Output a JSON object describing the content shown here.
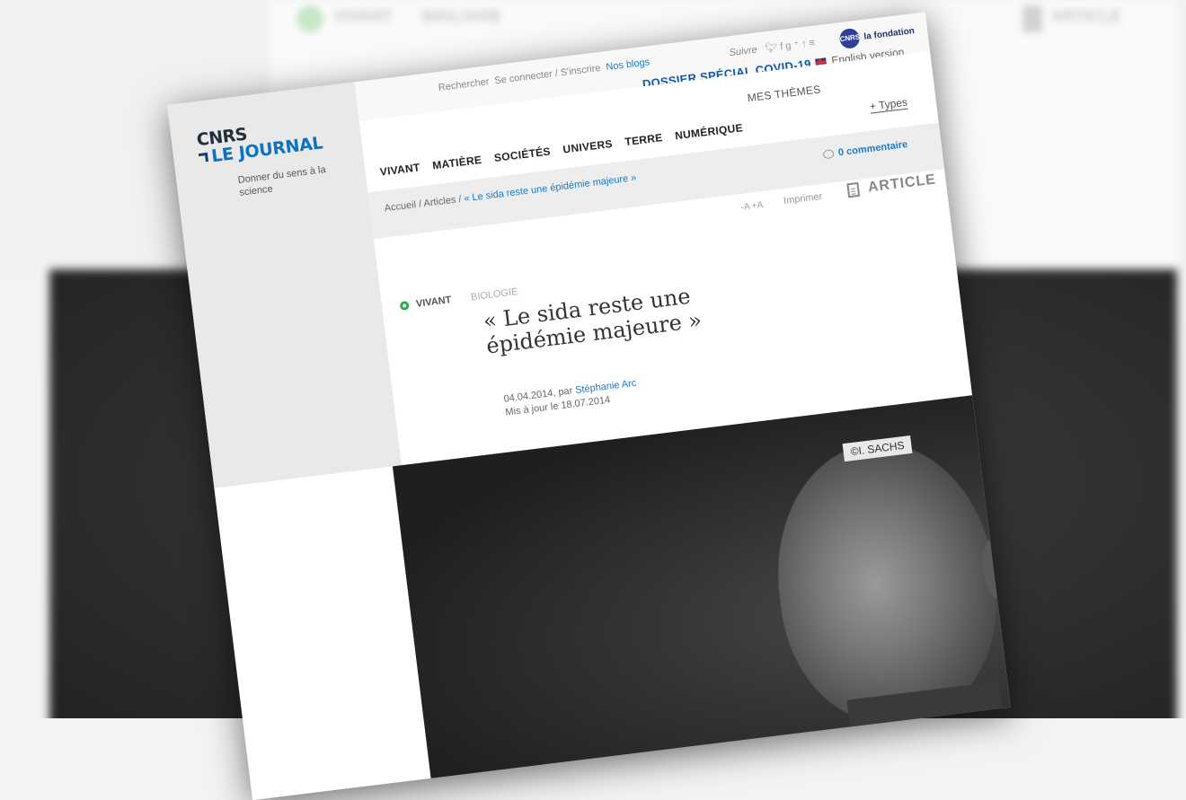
{
  "background": {
    "left_word": "VIVANT",
    "right_word": "BIOLOGIE",
    "article_word": "ARTICLE"
  },
  "logo": {
    "line1": "CNRS",
    "line2": "LE JOURNAL",
    "tagline": "Donner du sens à la science"
  },
  "topbar": {
    "search": "Rechercher",
    "login": "Se connecter / S'inscrire",
    "blogs": "Nos blogs",
    "follow": "Suivre",
    "social_icons": [
      "twitter-icon",
      "facebook-icon",
      "google-plus-icon",
      "share-icon",
      "rss-icon"
    ],
    "fondation": "la fondation",
    "fondation_badge": "CNRS",
    "covid": "DOSSIER SPÉCIAL COVID-19",
    "english": "English version"
  },
  "nav": {
    "items": [
      "VIVANT",
      "MATIÈRE",
      "SOCIÉTÉS",
      "UNIVERS",
      "TERRE",
      "NUMÉRIQUE"
    ],
    "mes_themes": "MES THÈMES",
    "types": "Types"
  },
  "breadcrumb": {
    "home": "Accueil",
    "articles": "Articles",
    "current": "« Le sida reste une épidémie majeure »"
  },
  "comments": "0 commentaire",
  "toolbar": {
    "font_size": "-A +A",
    "print": "Imprimer",
    "type_label": "ARTICLE"
  },
  "article": {
    "category": "VIVANT",
    "subcategory": "BIOLOGIE",
    "title": "« Le sida reste une épidémie majeure »",
    "date_prefix": "04.04.2014, par",
    "author": "Stéphanie Arc",
    "updated": "Mis à jour le 18.07.2014",
    "photo_credit": "©I. SACHS"
  },
  "colors": {
    "brand_blue": "#0b73c2",
    "link_blue": "#1a7bc8",
    "vivant_green": "#2fa84f"
  }
}
